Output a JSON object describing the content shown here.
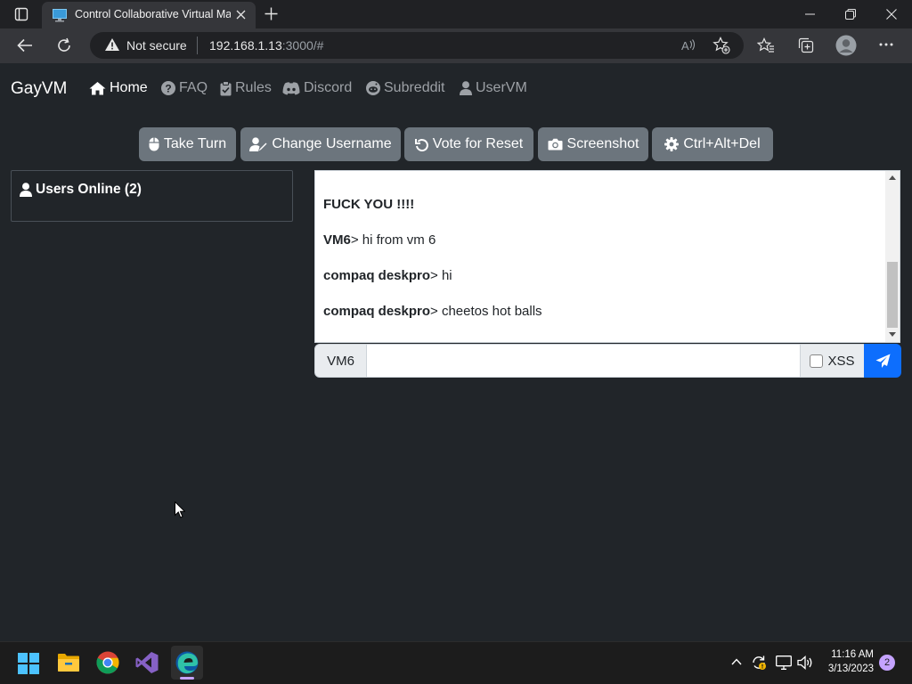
{
  "browser": {
    "tab_title": "Control Collaborative Virtual Ma",
    "address": {
      "security_label": "Not secure",
      "host": "192.168.1.13",
      "path": ":3000/#"
    }
  },
  "navbar": {
    "brand": "GayVM",
    "links": [
      {
        "label": "Home",
        "icon": "home-icon",
        "active": true
      },
      {
        "label": "FAQ",
        "icon": "question-circle-icon"
      },
      {
        "label": "Rules",
        "icon": "clipboard-icon"
      },
      {
        "label": "Discord",
        "icon": "discord-icon"
      },
      {
        "label": "Subreddit",
        "icon": "reddit-icon"
      },
      {
        "label": "UserVM",
        "icon": "user-icon"
      }
    ]
  },
  "vm_buttons": [
    {
      "label": "Take Turn",
      "icon": "mouse-icon"
    },
    {
      "label": "Change Username",
      "icon": "user-edit-icon"
    },
    {
      "label": "Vote for Reset",
      "icon": "undo-icon"
    },
    {
      "label": "Screenshot",
      "icon": "camera-icon"
    },
    {
      "label": "Ctrl+Alt+Del",
      "icon": "gear-icon"
    }
  ],
  "users_panel": {
    "title": "Users Online (2)"
  },
  "chat": {
    "messages": [
      {
        "user": "FUCK YOU !!!!",
        "sep": "",
        "text": ""
      },
      {
        "user": "VM6",
        "sep": ">",
        "text": " hi from vm 6"
      },
      {
        "user": "compaq deskpro",
        "sep": ">",
        "text": " hi"
      },
      {
        "user": "compaq deskpro",
        "sep": ">",
        "text": " cheetos hot balls"
      }
    ],
    "username_label": "VM6",
    "input_value": "",
    "xss_label": "XSS",
    "xss_checked": false
  },
  "taskbar": {
    "time": "11:16 AM",
    "date": "3/13/2023",
    "notification_count": "2"
  },
  "colors": {
    "page_bg": "#212529",
    "button_secondary": "#6c757d",
    "send_primary": "#0d6efd"
  }
}
